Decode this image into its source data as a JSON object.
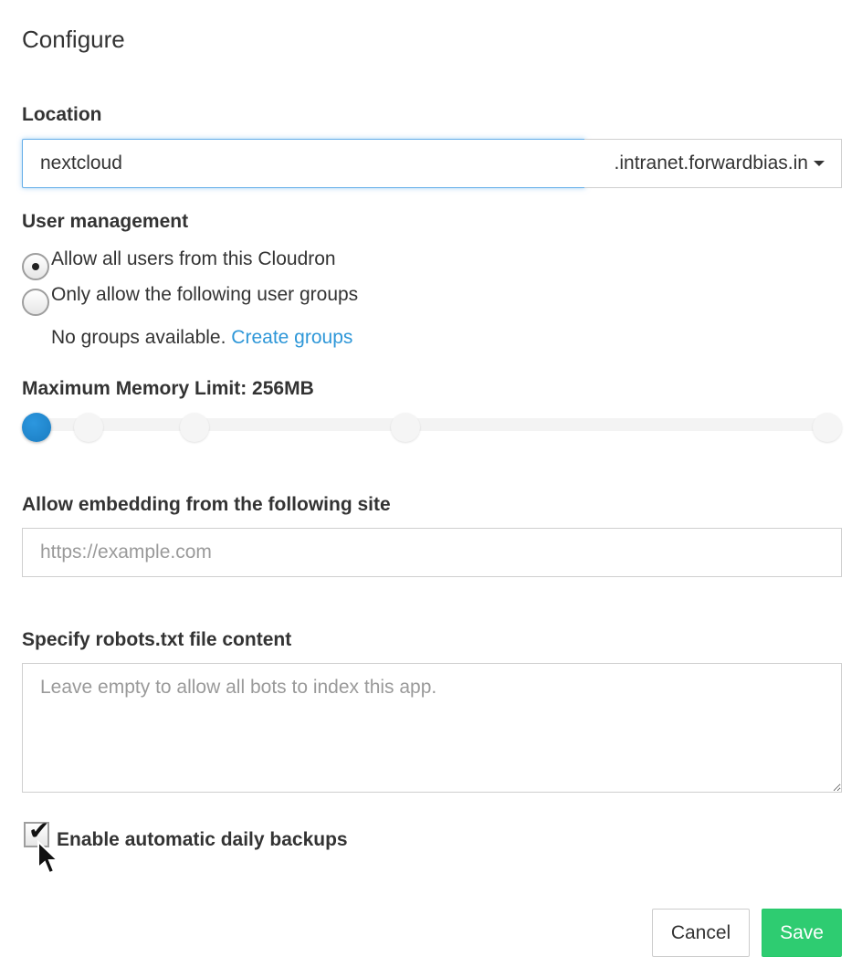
{
  "dialog": {
    "title": "Configure"
  },
  "location": {
    "label": "Location",
    "value": "nextcloud",
    "domain": ".intranet.forwardbias.in"
  },
  "user_management": {
    "label": "User management",
    "options": [
      {
        "label": "Allow all users from this Cloudron",
        "selected": true
      },
      {
        "label": "Only allow the following user groups",
        "selected": false
      }
    ],
    "no_groups_text": "No groups available.",
    "create_groups_link": "Create groups"
  },
  "memory": {
    "label": "Maximum Memory Limit: 256MB",
    "level_index": 0,
    "stop_count": 6
  },
  "embedding": {
    "label": "Allow embedding from the following site",
    "placeholder": "https://example.com",
    "value": ""
  },
  "robots": {
    "label": "Specify robots.txt file content",
    "placeholder": "Leave empty to allow all bots to index this app.",
    "value": ""
  },
  "backups": {
    "label": "Enable automatic daily backups",
    "checked": true
  },
  "footer": {
    "cancel_label": "Cancel",
    "save_label": "Save"
  },
  "colors": {
    "accent": "#2e97d8",
    "save": "#2ecc71",
    "slider_handle": "#1a7cc1"
  }
}
